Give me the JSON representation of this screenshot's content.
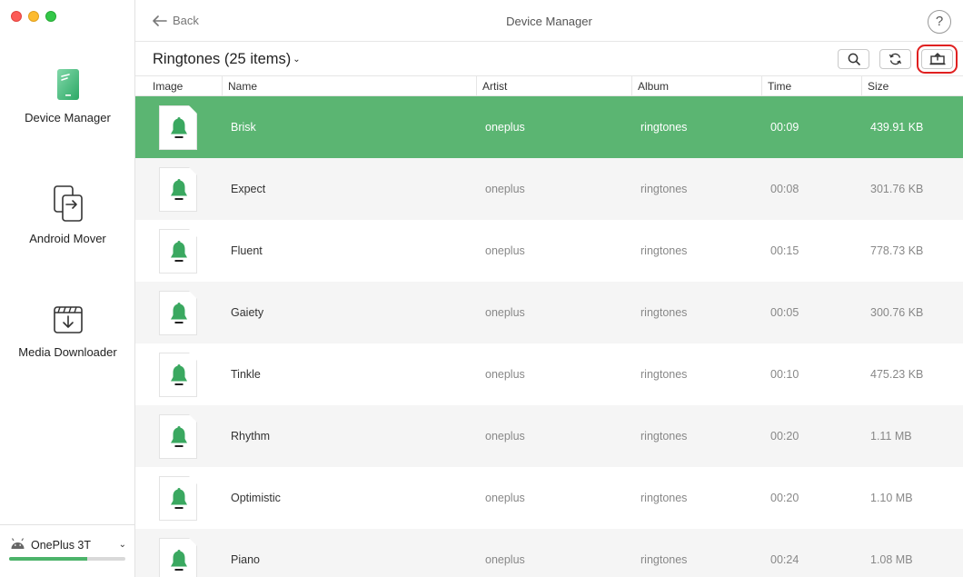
{
  "window": {
    "title": "Device Manager",
    "back_label": "Back",
    "help_label": "?"
  },
  "sidebar": {
    "items": [
      {
        "label": "Device Manager",
        "icon": "phone-icon",
        "active": true
      },
      {
        "label": "Android Mover",
        "icon": "transfer-icon",
        "active": false
      },
      {
        "label": "Media Downloader",
        "icon": "download-icon",
        "active": false
      }
    ],
    "device": {
      "name": "OnePlus 3T",
      "icon": "android-icon",
      "storage_used_fraction": 0.67
    }
  },
  "toolbar": {
    "category_label": "Ringtones (25 items)",
    "buttons": [
      "search-icon",
      "refresh-icon",
      "export-icon"
    ]
  },
  "table": {
    "headers": [
      "Image",
      "Name",
      "Artist",
      "Album",
      "Time",
      "Size"
    ],
    "rows": [
      {
        "name": "Brisk",
        "artist": "oneplus",
        "album": "ringtones",
        "time": "00:09",
        "size": "439.91 KB",
        "selected": true
      },
      {
        "name": "Expect",
        "artist": "oneplus",
        "album": "ringtones",
        "time": "00:08",
        "size": "301.76 KB"
      },
      {
        "name": "Fluent",
        "artist": "oneplus",
        "album": "ringtones",
        "time": "00:15",
        "size": "778.73 KB"
      },
      {
        "name": "Gaiety",
        "artist": "oneplus",
        "album": "ringtones",
        "time": "00:05",
        "size": "300.76 KB"
      },
      {
        "name": "Tinkle",
        "artist": "oneplus",
        "album": "ringtones",
        "time": "00:10",
        "size": "475.23 KB"
      },
      {
        "name": "Rhythm",
        "artist": "oneplus",
        "album": "ringtones",
        "time": "00:20",
        "size": "1.11 MB"
      },
      {
        "name": "Optimistic",
        "artist": "oneplus",
        "album": "ringtones",
        "time": "00:20",
        "size": "1.10 MB"
      },
      {
        "name": "Piano",
        "artist": "oneplus",
        "album": "ringtones",
        "time": "00:24",
        "size": "1.08 MB"
      }
    ]
  },
  "colors": {
    "accent": "#5bb572",
    "bell": "#3aa860",
    "highlight": "#e02020"
  }
}
